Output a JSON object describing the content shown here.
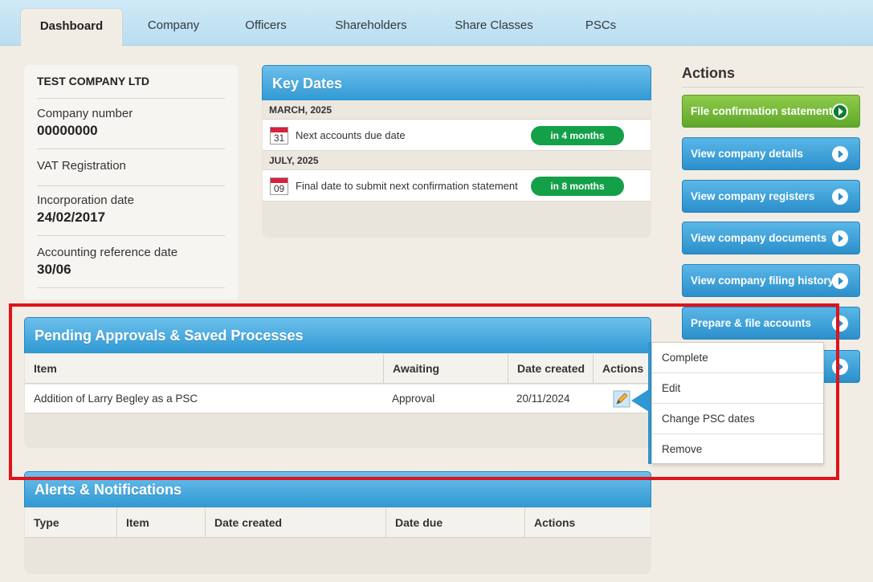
{
  "tabs": [
    {
      "label": "Dashboard",
      "active": true
    },
    {
      "label": "Company"
    },
    {
      "label": "Officers"
    },
    {
      "label": "Shareholders"
    },
    {
      "label": "Share Classes"
    },
    {
      "label": "PSCs"
    }
  ],
  "company": {
    "name": "TEST COMPANY LTD",
    "number_label": "Company number",
    "number_value": "00000000",
    "vat_label": "VAT Registration",
    "incorporation_label": "Incorporation date",
    "incorporation_value": "24/02/2017",
    "ard_label": "Accounting reference date",
    "ard_value": "30/06"
  },
  "key_dates": {
    "title": "Key Dates",
    "groups": [
      {
        "month": "MARCH, 2025",
        "day": "31",
        "text": "Next accounts due date",
        "badge": "in 4 months"
      },
      {
        "month": "JULY, 2025",
        "day": "09",
        "text": "Final date to submit next confirmation statement",
        "badge": "in 8 months"
      }
    ]
  },
  "actions": {
    "title": "Actions",
    "buttons": [
      "File confirmation statement",
      "View company details",
      "View company registers",
      "View company documents",
      "View company filing history",
      "Prepare & file accounts"
    ]
  },
  "pending": {
    "title": "Pending Approvals & Saved Processes",
    "columns": [
      "Item",
      "Awaiting",
      "Date created",
      "Actions"
    ],
    "rows": [
      {
        "item": "Addition of Larry Begley as a PSC",
        "awaiting": "Approval",
        "date": "20/11/2024"
      }
    ]
  },
  "menu": {
    "items": [
      "Complete",
      "Edit",
      "Change PSC dates",
      "Remove"
    ]
  },
  "alerts": {
    "title": "Alerts & Notifications",
    "columns": [
      "Type",
      "Item",
      "Date created",
      "Date due",
      "Actions"
    ]
  },
  "colors": {
    "accent_blue": "#2f98d3",
    "badge_green": "#14a048",
    "highlight_red": "#e0121b"
  }
}
